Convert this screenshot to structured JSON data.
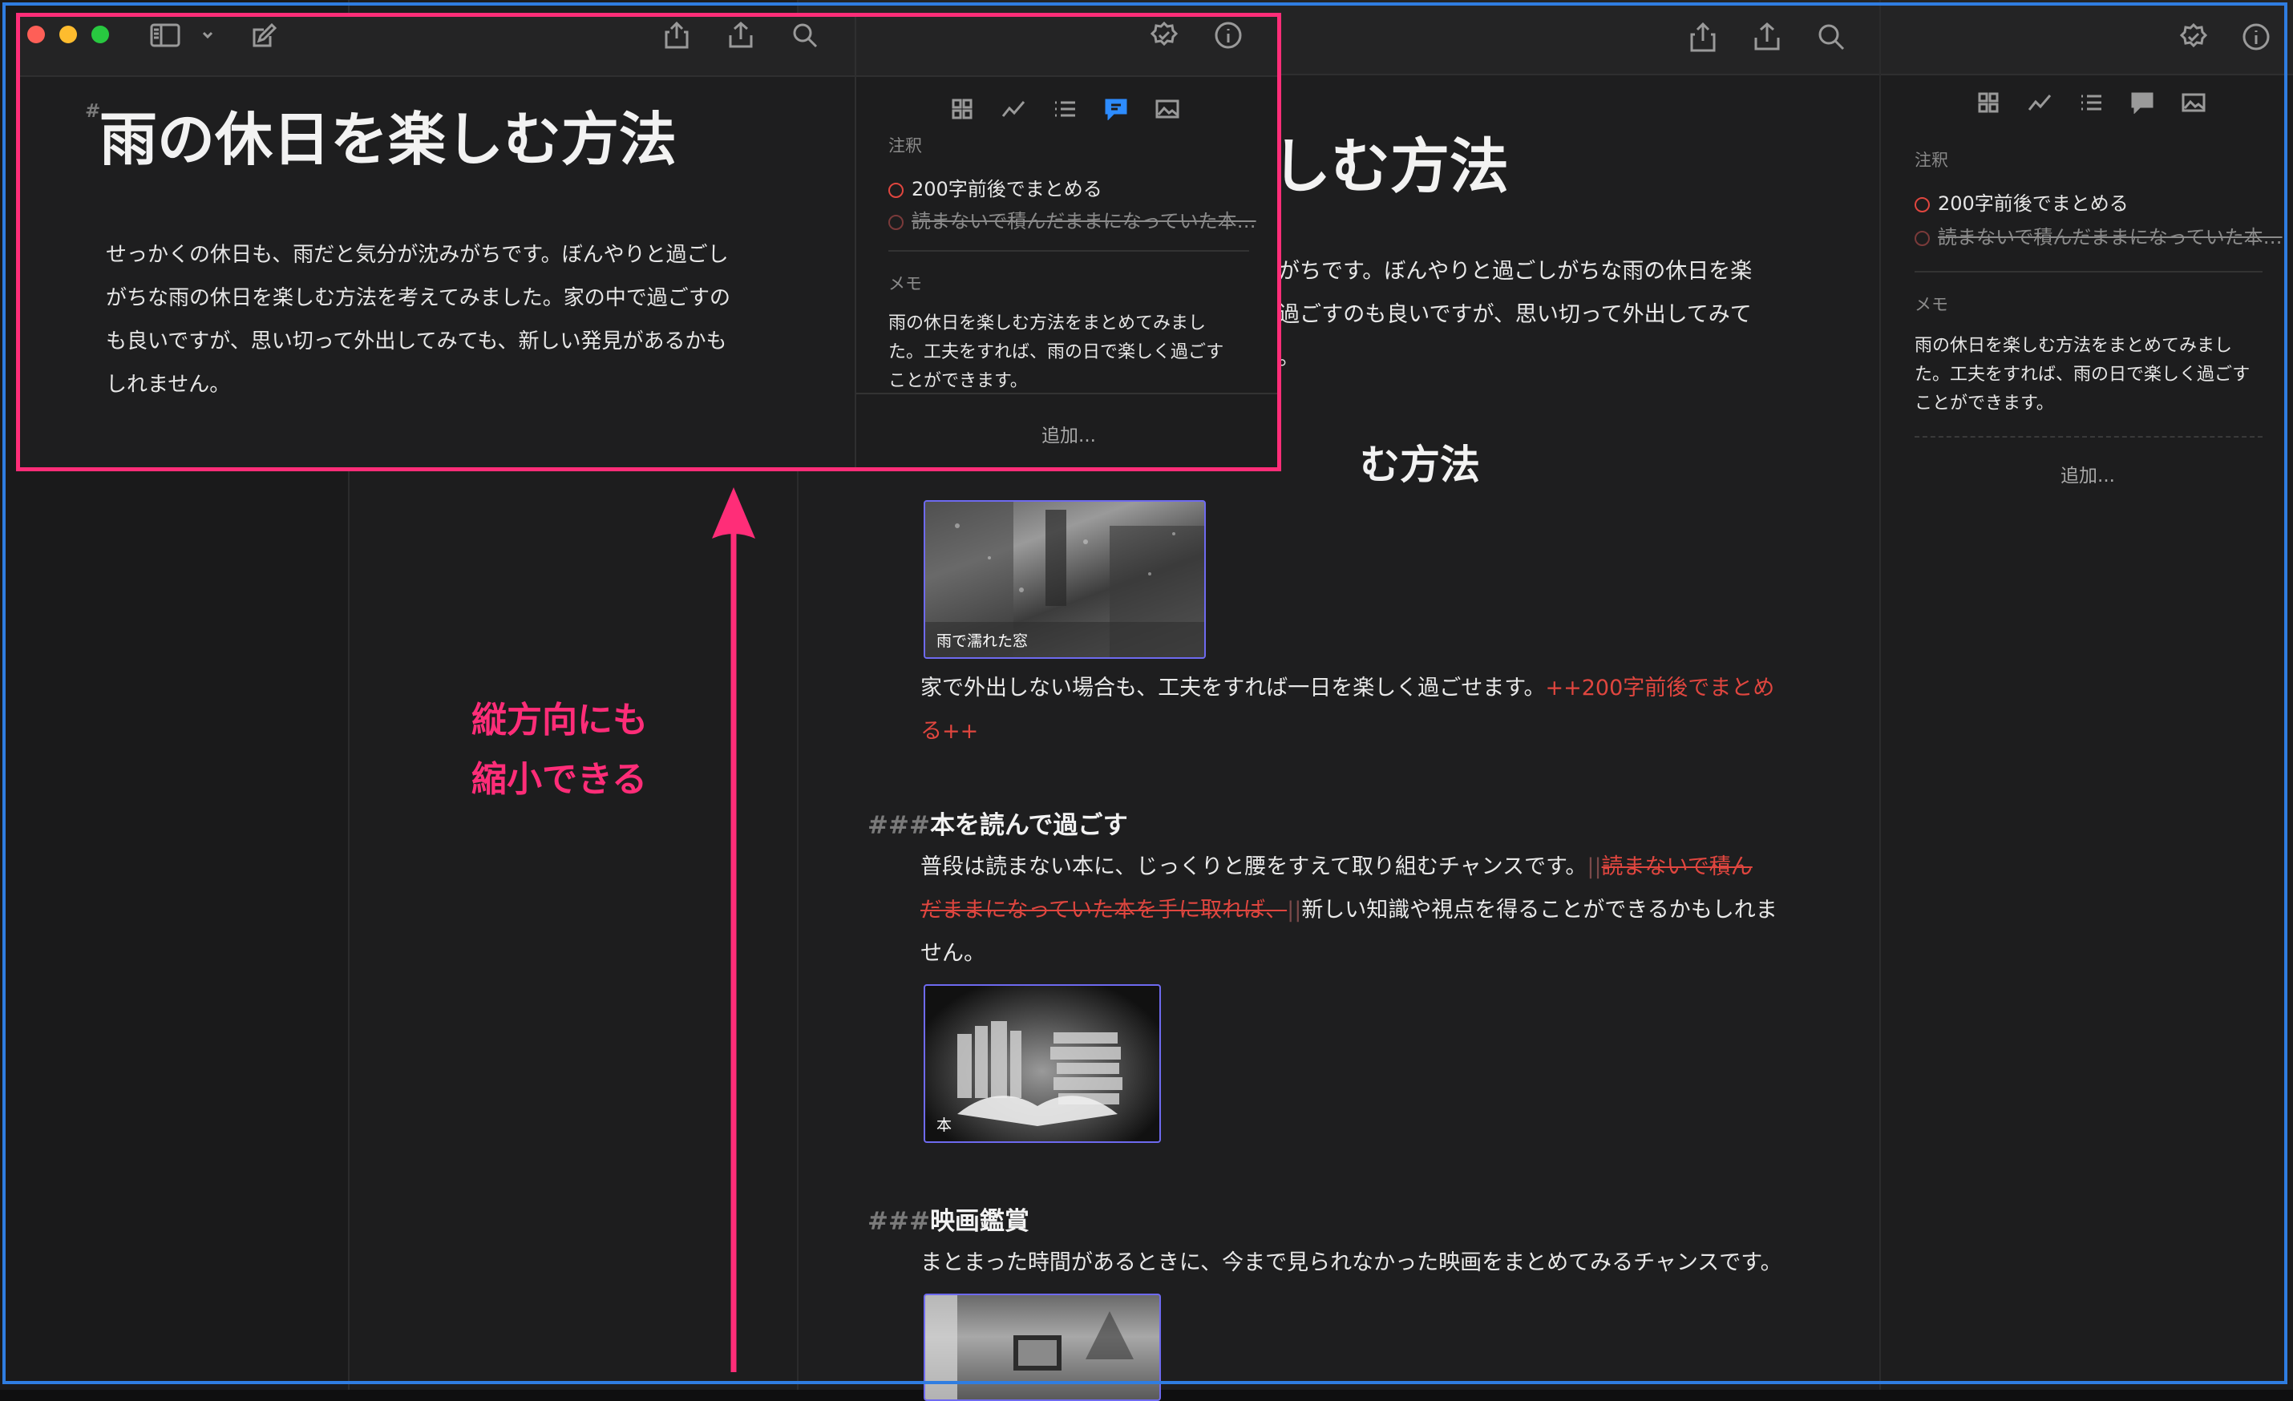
{
  "doc": {
    "title": "雨の休日を楽しむ方法",
    "title_hash": "#",
    "intro": [
      "せっかくの休日も、雨だと気分が沈みがちです。ぼんやりと過ごし",
      "がちな雨の休日を楽しむ方法を考えてみました。家の中で過ごすの",
      "も良いですが、思い切って外出してみても、新しい発見があるかも",
      "しれません。"
    ],
    "bg_intro": [
      "がちです。ぼんやりと過ごしがちな雨の休日を楽",
      "過ごすのも良いですが、思い切って外出してみて",
      "。"
    ],
    "bg_title_visible": "しむ方法",
    "section_heading_partial": "む方法",
    "image1_caption": "雨で濡れた窓",
    "para_home": "家で外出しない場合も、工夫をすれば一日を楽しく過ごせます。",
    "para_home_insert": "++200字前後でまとめ",
    "para_home_insert2": "る++",
    "h_books_hash": "###",
    "h_books": "本を読んで過ごす",
    "books_line1": "普段は読まない本に、じっくりと腰をすえて取り組むチャンスです。",
    "books_del_mark": "||",
    "books_del1": "読まないで積ん",
    "books_del2": "だままになっていた本を手に取れば、",
    "books_del_mark2": "||",
    "books_line2": "新しい知識や視点を得ることができるかもしれま",
    "books_line3": "せん。",
    "image2_caption": "本",
    "h_movie_hash": "###",
    "h_movie": "映画鑑賞",
    "movie_line": "まとまった時間があるときに、今まで見られなかった映画をまとめてみるチャンスです。"
  },
  "inspector": {
    "annotations_label": "注釈",
    "annotation1": "200字前後でまとめる",
    "annotation2": "読まないで積んだままになっていた本…",
    "memo_label": "メモ",
    "memo_lines": [
      "雨の休日を楽しむ方法をまとめてみまし",
      "た。工夫をすれば、雨の日で楽しく過ごす",
      "ことができます。"
    ],
    "add_label": "追加..."
  },
  "annotation_text": [
    "縦方向にも",
    "縮小できる"
  ],
  "colors": {
    "accent_blue": "#2f7de1",
    "highlight_pink": "#ff2d78",
    "markup_red": "#e0463f",
    "active_tab": "#2d8cff"
  },
  "icons": {
    "toolbar": [
      "sidebar-toggle-icon",
      "chevron-down-icon",
      "compose-icon",
      "share-icon",
      "export-icon",
      "search-icon",
      "check-badge-icon",
      "info-icon"
    ],
    "inspector_tabs": [
      "overview-grid-icon",
      "statistics-icon",
      "outline-list-icon",
      "annotations-icon",
      "images-icon"
    ]
  }
}
